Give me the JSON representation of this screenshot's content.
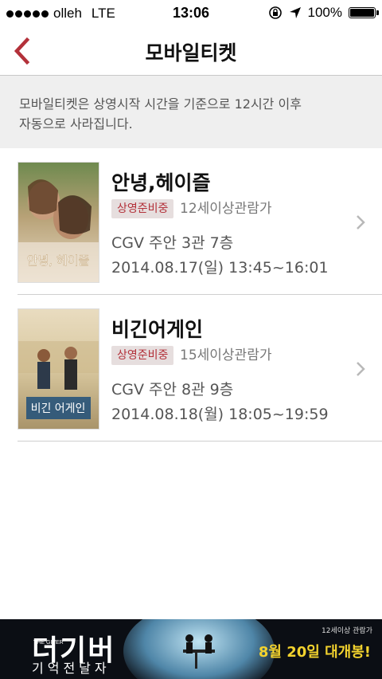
{
  "status_bar": {
    "carrier": "olleh",
    "network": "LTE",
    "time": "13:06",
    "battery": "100%",
    "battery_level": 1.0
  },
  "nav": {
    "title": "모바일티켓",
    "back_icon": "chevron-left-icon"
  },
  "notice": {
    "line1": "모바일티켓은 상영시작 시간을 기준으로 12시간 이후",
    "line2": "자동으로 사라집니다."
  },
  "tickets": [
    {
      "title": "안녕,헤이즐",
      "status_badge": "상영준비중",
      "rating": "12세이상관람가",
      "theater": "CGV 주안 3관 7층",
      "showtime": "2014.08.17(일) 13:45~16:01",
      "poster_text": "안녕, 헤이즐"
    },
    {
      "title": "비긴어게인",
      "status_badge": "상영준비중",
      "rating": "15세이상관람가",
      "theater": "CGV 주안 8관 9층",
      "showtime": "2014.08.18(월) 18:05~19:59",
      "poster_text": "비긴 어게인"
    }
  ],
  "ad": {
    "title": "더기버",
    "title_en": "THE GIVER",
    "subtitle": "기억전달자",
    "rating": "12세이상 관람가",
    "release": "8월 20일 대개봉!"
  },
  "colors": {
    "accent": "#b3313a",
    "badge_bg": "#e6dede",
    "notice_bg": "#efefef",
    "ad_highlight": "#f2d22e"
  }
}
